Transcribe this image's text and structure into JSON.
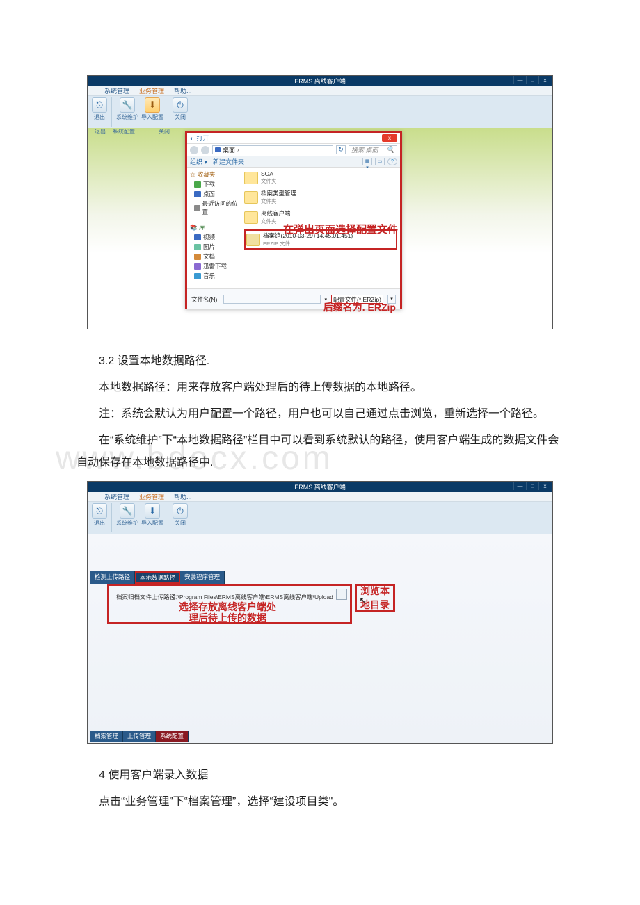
{
  "app_title": "ERMS 离线客户端",
  "win_buttons": {
    "min": "—",
    "max": "□",
    "close": "x"
  },
  "menu": {
    "sys_mgmt": "系统管理",
    "biz_mgmt": "业务管理",
    "help": "帮助..."
  },
  "ribbon": {
    "exit": "退出",
    "sys_maint": "系统维护",
    "import_cfg": "导入配置",
    "close": "关闭",
    "sub_exit": "退出",
    "sub_syscfg": "系统配置",
    "sub_close": "关闭"
  },
  "open_dialog": {
    "title": "打开",
    "crumb_desktop": "桌面",
    "crumb_sep": "›",
    "search_placeholder": "搜索 桌面",
    "toolbar_org": "组织 ▾",
    "toolbar_new": "新建文件夹",
    "view_btn": "▦ ▾",
    "help_btn": "?",
    "sidebar": {
      "fav_head": "☆ 收藏夹",
      "downloads": "下载",
      "desktop": "桌面",
      "recent": "最近访问的位置",
      "lib_head": "库",
      "videos": "视频",
      "pictures": "图片",
      "docs": "文档",
      "thunder": "迅雷下载",
      "music": "音乐"
    },
    "files": [
      {
        "name": "SOA",
        "sub": "文件夹"
      },
      {
        "name": "档案类型管理",
        "sub": "文件夹"
      },
      {
        "name": "离线客户端",
        "sub": "文件夹"
      },
      {
        "name": "档案馆(2010-03-29+14.45.01.451)",
        "sub": "ERZIP 文件",
        "selected": true
      }
    ],
    "annotation_select": "在弹出页面选择配置文件",
    "filename_label": "文件名(N):",
    "filter_text": "配置文件(*.ERZip)",
    "annotation_ext": "后缀名为. ERZip"
  },
  "doc": {
    "p32_title": "3.2 设置本地数据路径.",
    "p32_a": "本地数据路径：用来存放客户端处理后的待上传数据的本地路径。",
    "p32_b": "注：系统会默认为用户配置一个路径，用户也可以自己通过点击浏览，重新选择一个路径。",
    "p32_c": "在“系统维护”下“本地数据路径”栏目中可以看到系统默认的路径，使用客户端生成的数据文件会自动保存在本地数据路径中.",
    "watermark": "www.bdocx.com",
    "p4_title": "4 使用客户端录入数据",
    "p4_a": "点击“业务管理”下“档案管理”，选择“建设项目类\"。"
  },
  "second_window": {
    "tabs": {
      "t1": "检测上传路径",
      "t2": "本地数据路径",
      "t3": "安装程序管理"
    },
    "path_label": "档案归档文件上传路径：",
    "path_value": "C:\\Program Files\\ERMS离线客户端\\ERMS离线客户端\\Upload",
    "anno_main": "选择存放离线客户端处\n理后待上传的数据",
    "anno_browse": "浏览本\n地目录",
    "bottom_tabs": {
      "b1": "档案管理",
      "b2": "上传管理",
      "b3": "系统配置"
    }
  }
}
